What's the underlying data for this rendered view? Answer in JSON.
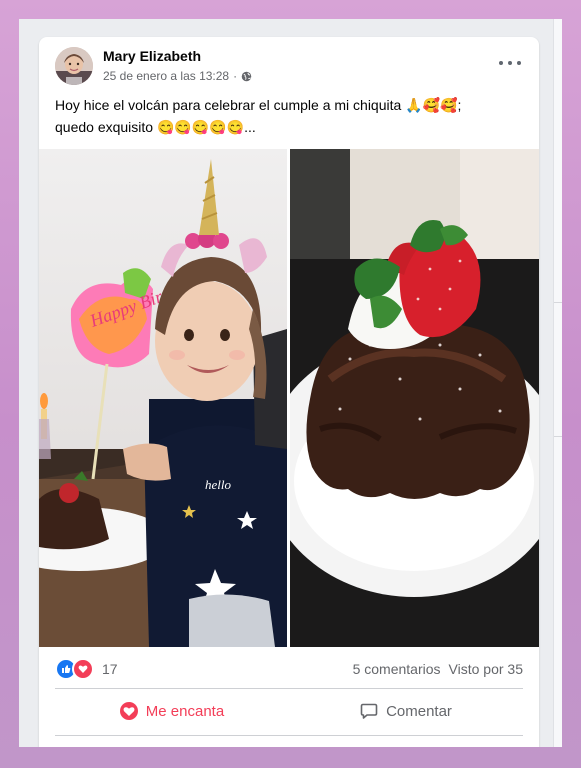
{
  "post": {
    "author": "Mary Elizabeth",
    "timestamp": "25 de enero a las 13:28",
    "separator": "·",
    "text_line1": "Hoy hice el volcán para celebrar el cumple a mi chiquita 🙏🥰🥰;",
    "text_line2": "quedo exquisito 😋😋😋😋😋...",
    "privacy_icon": "globe-icon",
    "more_icon": "more-options-icon"
  },
  "photos": [
    {
      "name": "girl-with-unicorn-headband",
      "topper_text": "Happy Birthday"
    },
    {
      "name": "chocolate-volcano-cake"
    }
  ],
  "stats": {
    "reaction_icons": [
      "like-reaction-icon",
      "love-reaction-icon"
    ],
    "reaction_count": "17",
    "comments": "5 comentarios",
    "views": "Visto por 35"
  },
  "actions": {
    "love_label": "Me encanta",
    "comment_label": "Comentar"
  },
  "colors": {
    "love": "#f33e58",
    "like": "#1877f2",
    "secondary_text": "#65676b"
  }
}
